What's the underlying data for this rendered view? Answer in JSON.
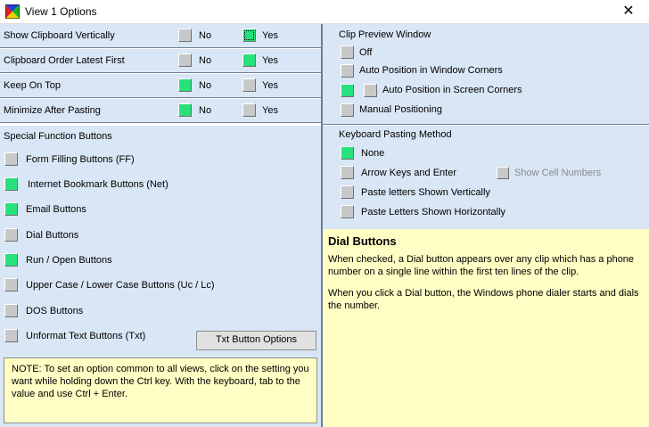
{
  "window": {
    "title": "View 1 Options",
    "close_glyph": "✕"
  },
  "left_rows": [
    {
      "label": "Show Clipboard Vertically",
      "underline": "S",
      "no_label": "No",
      "yes_label": "Yes",
      "no_on": false,
      "yes_on": true
    },
    {
      "label": "Clipboard Order Latest First",
      "underline": "",
      "no_label": "No",
      "yes_label": "Yes",
      "no_on": false,
      "yes_on": true
    },
    {
      "label": "Keep On Top",
      "underline": "O",
      "no_label": "No",
      "yes_label": "Yes",
      "no_on": true,
      "yes_on": false
    },
    {
      "label": "Minimize After Pasting",
      "underline": "M",
      "no_label": "No",
      "yes_label": "Yes",
      "no_on": true,
      "yes_on": false
    }
  ],
  "clip_preview": {
    "title": "Clip Preview Window",
    "options": [
      {
        "label": "Off",
        "on": false
      },
      {
        "label": "Auto Position in Window Corners",
        "on": false
      },
      {
        "label": "Auto Position in Screen Corners",
        "on": true
      },
      {
        "label": "Manual Positioning",
        "on": false
      }
    ]
  },
  "special": {
    "title": "Special Function Buttons",
    "items": [
      {
        "label": "Form Filling Buttons (FF)",
        "on": false
      },
      {
        "label": "Internet Bookmark Buttons (Net)",
        "on": true
      },
      {
        "label": "Email Buttons",
        "on": true
      },
      {
        "label": "Dial Buttons",
        "on": false
      },
      {
        "label": "Run / Open Buttons",
        "on": true
      },
      {
        "label": "Upper Case / Lower Case Buttons (Uc / Lc)",
        "on": false
      },
      {
        "label": "DOS Buttons",
        "on": false
      },
      {
        "label": "Unformat Text Buttons (Txt)",
        "on": false
      }
    ],
    "txt_button_label": "Txt Button Options"
  },
  "note_text": "NOTE:  To set an option common to all views, click on the setting you want while holding down the Ctrl key. With the keyboard, tab to the value and use Ctrl + Enter.",
  "keyboard": {
    "title": "Keyboard Pasting Method",
    "options": [
      {
        "label": "None",
        "on": true
      },
      {
        "label": "Arrow Keys and Enter",
        "on": false
      },
      {
        "label": "Paste letters Shown Vertically",
        "on": false
      },
      {
        "label": "Paste Letters Shown Horizontally",
        "on": false
      }
    ],
    "show_cell_numbers": "Show Cell Numbers"
  },
  "help": {
    "title": "Dial Buttons",
    "p1": "When checked, a Dial button appears over any clip which has a phone number on a single line within the first ten lines of the clip.",
    "p2": "When you click a Dial button, the Windows phone dialer starts and dials the number."
  },
  "colors": {
    "panel": "#d9e6f5",
    "checked": "#28e07c",
    "note": "#fffec4"
  }
}
